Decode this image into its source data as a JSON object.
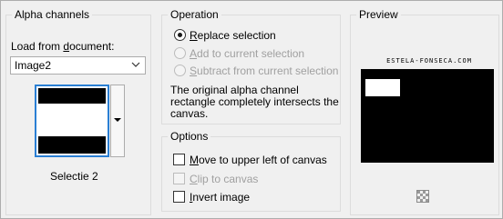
{
  "alpha_channels": {
    "title": "Alpha channels",
    "load_label_pre": "Load from ",
    "load_label_key": "d",
    "load_label_post": "ocument:",
    "document_value": "Image2",
    "thumbnail_caption": "Selectie 2"
  },
  "operation": {
    "title": "Operation",
    "options": [
      {
        "key": "R",
        "rest": "eplace selection",
        "selected": true,
        "enabled": true
      },
      {
        "key": "A",
        "rest": "dd to current selection",
        "selected": false,
        "enabled": false
      },
      {
        "key": "S",
        "rest": "ubtract from current selection",
        "selected": false,
        "enabled": false
      }
    ],
    "message_line1": "The original alpha channel",
    "message_line2": "rectangle completely intersects the",
    "message_line3": "canvas."
  },
  "options": {
    "title": "Options",
    "items": [
      {
        "key": "M",
        "rest": "ove to upper left of canvas",
        "checked": false,
        "enabled": true
      },
      {
        "key": "C",
        "rest": "lip to canvas",
        "checked": false,
        "enabled": false
      },
      {
        "key": "I",
        "rest": "nvert image",
        "checked": false,
        "enabled": true
      }
    ]
  },
  "preview": {
    "title": "Preview",
    "watermark": "ESTELA-FONSECA.COM"
  },
  "colors": {
    "accent": "#2a7fd4",
    "disabled_text": "#a0a0a0"
  }
}
